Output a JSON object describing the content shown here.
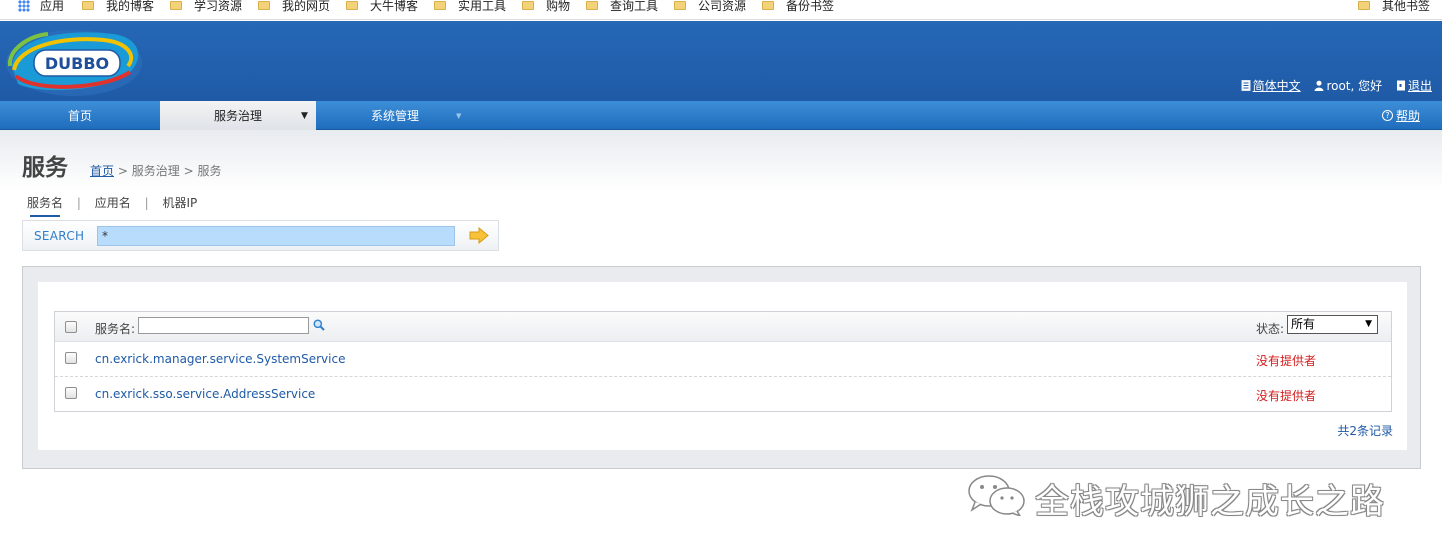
{
  "bookmarks": {
    "apps": "应用",
    "items": [
      {
        "label": "我的博客"
      },
      {
        "label": "学习资源"
      },
      {
        "label": "我的网页"
      },
      {
        "label": "大牛博客"
      },
      {
        "label": "实用工具"
      },
      {
        "label": "购物"
      },
      {
        "label": "查询工具"
      },
      {
        "label": "公司资源"
      },
      {
        "label": "备份书签"
      }
    ],
    "other": "其他书签"
  },
  "header": {
    "logo_text": "DUBBO",
    "language": "简体中文",
    "user": "root, 您好",
    "logout": "退出"
  },
  "nav": {
    "items": [
      {
        "label": "首页"
      },
      {
        "label": "服务治理",
        "arrow": "▼"
      },
      {
        "label": "系统管理",
        "arrow": "▼"
      }
    ],
    "help": "帮助"
  },
  "page": {
    "title": "服务",
    "breadcrumb": {
      "home": "首页",
      "sep": ">",
      "level1": "服务治理",
      "level2": "服务"
    }
  },
  "search": {
    "tabs": [
      {
        "label": "服务名"
      },
      {
        "label": "应用名"
      },
      {
        "label": "机器IP"
      }
    ],
    "tab_sep": "|",
    "label": "SEARCH",
    "value": "*"
  },
  "grid": {
    "filter_label": "服务名:",
    "filter_value": "",
    "status_label": "状态:",
    "status_selected": "所有",
    "rows": [
      {
        "service": "cn.exrick.manager.service.SystemService",
        "status": "没有提供者"
      },
      {
        "service": "cn.exrick.sso.service.AddressService",
        "status": "没有提供者"
      }
    ],
    "total": "共2条记录"
  },
  "watermark": {
    "text": "全栈攻城狮之成长之路"
  }
}
